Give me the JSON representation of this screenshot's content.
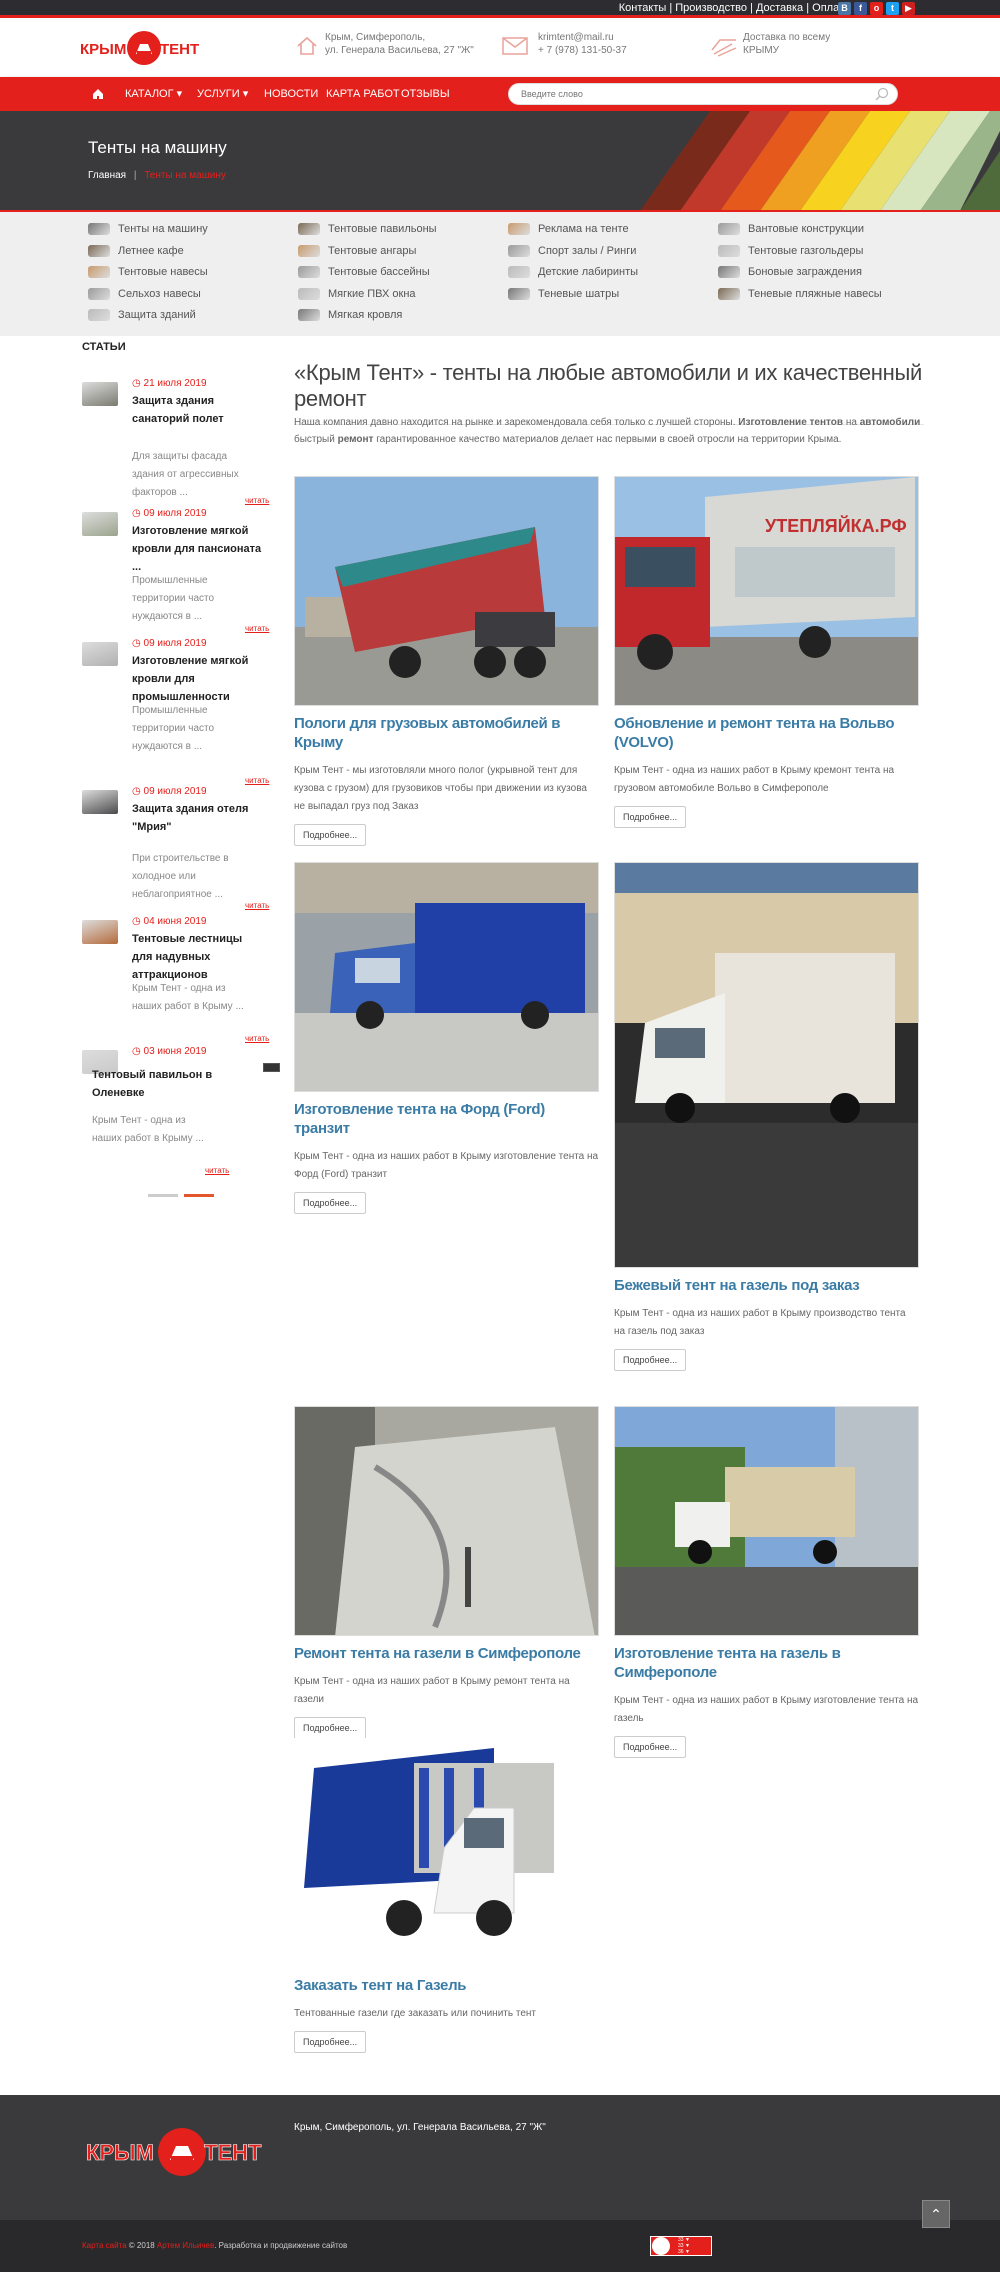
{
  "topbar": {
    "links": "Контакты | Производство | Доставка | Оплата",
    "social": [
      {
        "icon": "vk-icon",
        "label": "В",
        "color": "#4a76a8"
      },
      {
        "icon": "facebook-icon",
        "label": "f",
        "color": "#3b5998"
      },
      {
        "icon": "odnoklassniki-icon",
        "label": "о",
        "color": "#e3201c"
      },
      {
        "icon": "twitter-icon",
        "label": "t",
        "color": "#1da1f2"
      },
      {
        "icon": "youtube-icon",
        "label": "▶",
        "color": "#cd201f"
      }
    ]
  },
  "header": {
    "logo_text": "КРЫМ ТЕНТ",
    "address_l1": "Крым, Симферополь,",
    "address_l2": "ул. Генерала Васильева, 27 \"Ж\"",
    "email": "krimtent@mail.ru",
    "phone": "+ 7 (978) 131-50-37",
    "delivery_l1": "Доставка по всему",
    "delivery_l2": "КРЫМУ"
  },
  "nav": {
    "home_icon": "home-icon",
    "items": [
      "КАТАЛОГ",
      "УСЛУГИ",
      "НОВОСТИ",
      "КАРТА РАБОТ",
      "ОТЗЫВЫ"
    ],
    "search_placeholder": "Введите слово"
  },
  "hero": {
    "title": "Тенты на машину",
    "crumb_home": "Главная",
    "crumb_sep": "|",
    "crumb_current": "Тенты на машину"
  },
  "categories": [
    [
      "Тенты на машину",
      "Летнее кафе",
      "Тентовые навесы",
      "Сельхоз навесы",
      "Защита зданий"
    ],
    [
      "Тентовые павильоны",
      "Тентовые ангары",
      "Тентовые бассейны",
      "Мягкие ПВХ окна",
      "Мягкая кровля"
    ],
    [
      "Реклама на тенте",
      "Спорт залы / Ринги",
      "Детские лабиринты",
      "Теневые шатры"
    ],
    [
      "Вантовые конструкции",
      "Тентовые газгольдеры",
      "Боновые заграждения",
      "Теневые пляжные навесы"
    ]
  ],
  "sidebar": {
    "title": "СТАТЬИ",
    "articles": [
      {
        "date": "21 июля 2019",
        "title": "Защита здания санаторий полет",
        "excerpt": "Для защиты фасада здания от агрессивных факторов ...",
        "more": "читать"
      },
      {
        "date": "09 июля 2019",
        "title": "Изготовление мягкой кровли для пансионата ...",
        "excerpt": "Промышленные территории часто нуждаются в ...",
        "more": "читать"
      },
      {
        "date": "09 июля 2019",
        "title": "Изготовление мягкой кровли для промышленности",
        "excerpt": "Промышленные территории часто нуждаются в ...",
        "more": "читать"
      },
      {
        "date": "09 июля 2019",
        "title": "Защита здания отеля \"Мрия\"",
        "excerpt": "При строительстве в холодное или неблагоприятное ...",
        "more": "читать"
      },
      {
        "date": "04 июня 2019",
        "title": "Тентовые лестницы для надувных аттракционов",
        "excerpt": "Крым Тент - одна из наших работ в Крыму ...",
        "more": "читать"
      },
      {
        "date": "03 июня 2019",
        "title": "Тентовый павильон в Оленевке",
        "excerpt": "Крым Тент - одна из наших работ в Крыму ...",
        "more": "читать"
      }
    ]
  },
  "main": {
    "heading": "«Крым Тент» - тенты на любые автомобили и их качественный ремонт",
    "intro_a": "Наша компания давно находится на рынке и зарекомендовала себя только с лучшей стороны. ",
    "intro_b": "Изготовление тентов",
    "intro_c": " на ",
    "intro_d": "автомобили",
    "intro_e": " быстрый ",
    "intro_f": "ремонт",
    "intro_g": " гарантированное качество материалов делает нас первыми в своей отросли на территории Крыма.",
    "more_label": "Подробнее...",
    "cards": [
      {
        "title": "Пологи для грузовых автомобилей в Крыму",
        "desc": "Крым Тент - мы изготовляли много полог (укрывной тент для кузова с грузом) для грузовиков чтобы при движении из кузова не выпадал груз под Заказ"
      },
      {
        "title": "Обновление и ремонт тента на Вольво (VOLVO)",
        "desc": "Крым Тент - одна из наших работ в Крыму кремонт тента на грузовом автомобиле Вольво в Симферополе"
      },
      {
        "title": "Изготовление тента на Форд (Ford) транзит",
        "desc": "Крым Тент - одна из наших работ в Крыму изготовление тента на Форд (Ford) транзит"
      },
      {
        "title": "Бежевый тент на газель под заказ",
        "desc": "Крым Тент - одна из наших работ в Крыму производство тента на газель под заказ"
      },
      {
        "title": "Ремонт тента на газели в Симферополе",
        "desc": "Крым Тент - одна из наших работ в Крыму ремонт тента на газели"
      },
      {
        "title": "Изготовление тента на газель в Симферополе",
        "desc": "Крым Тент - одна из наших работ в Крыму изготовление тента на газель"
      },
      {
        "title": "Заказать тент на Газель",
        "desc": "Тентованные газели где заказать или починить тент"
      }
    ]
  },
  "footer": {
    "address": "Крым, Симферополь, ул. Генерала Васильева, 27 \"Ж\"",
    "copy_a": "Карта сайта",
    "copy_b": " © 2018 ",
    "copy_c": "Артем Ильичев",
    "copy_d": ". Разработка и продвижение сайтов",
    "counter_l1": "33 ▼",
    "counter_l2": "33 ▼",
    "counter_l3": "36 ▼",
    "totop_icon": "arrow-up-icon"
  },
  "colors": {
    "accent": "#e3201c",
    "dark": "#3a3a3c",
    "link": "#3a7ca5"
  }
}
